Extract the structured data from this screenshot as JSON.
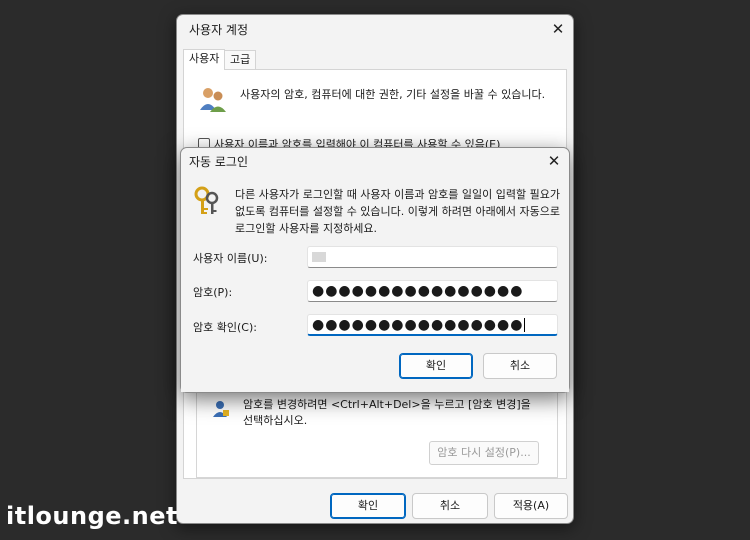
{
  "back_dialog": {
    "title": "사용자 계정",
    "close": "✕",
    "tabs": [
      {
        "label": "사용자"
      },
      {
        "label": "고급"
      }
    ],
    "intro": "사용자의 암호, 컴퓨터에 대한 권한, 기타 설정을 바꿀 수 있습니다.",
    "checkbox_label": "사용자 이름과 암호를 입력해야 이 컴퓨터를 사용할 수 있음(E)",
    "checkbox_checked": false,
    "password_text": "암호를 변경하려면 <Ctrl+Alt+Del>을 누르고 [암호 변경]을 선택하십시오.",
    "reset_button": "암호 다시 설정(P)...",
    "ok_button": "확인",
    "cancel_button": "취소",
    "apply_button": "적용(A)"
  },
  "front_dialog": {
    "title": "자동 로그인",
    "close": "✕",
    "description": "다른 사용자가 로그인할 때 사용자 이름과 암호를 일일이 입력할 필요가 없도록 컴퓨터를 설정할 수 있습니다. 이렇게 하려면 아래에서 자동으로 로그인할 사용자를 지정하세요.",
    "username_label": "사용자 이름(U):",
    "password_label": "암호(P):",
    "password_value": "●●●●●●●●●●●●●●●●",
    "confirm_label": "암호 확인(C):",
    "confirm_value": "●●●●●●●●●●●●●●●●",
    "ok_button": "확인",
    "cancel_button": "취소"
  },
  "watermark": "itlounge.net",
  "colors": {
    "background": "#2b2b2b",
    "accent": "#0067c0"
  }
}
